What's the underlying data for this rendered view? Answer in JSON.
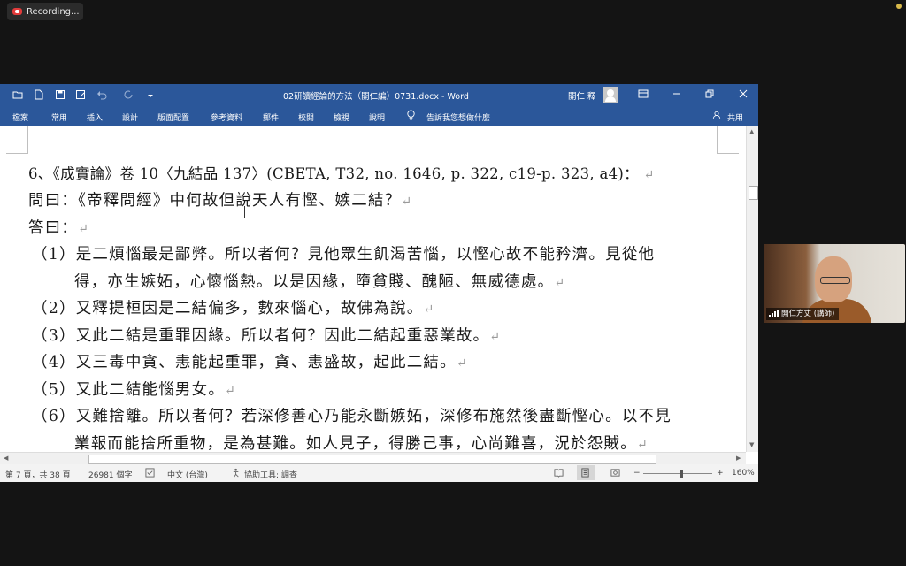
{
  "recording": {
    "label": "Recording..."
  },
  "word": {
    "doc_title": "02研讀經論的方法（開仁編）0731.docx  -  Word",
    "user": "開仁 釋",
    "tabs": [
      "檔案",
      "常用",
      "插入",
      "設計",
      "版面配置",
      "參考資料",
      "郵件",
      "校閱",
      "檢視",
      "說明"
    ],
    "tell_me": "告訴我您想做什麼",
    "share": "共用",
    "doc_lines": [
      "6、《成實論》卷 10〈九結品  137〉(CBETA, T32, no. 1646, p. 322, c19-p. 323, a4)：",
      "問曰：《帝釋問經》中何故但說天人有慳、嫉二結？",
      "答曰：",
      "（1）是二煩惱最是鄙弊。所以者何？見他眾生飢渴苦惱，以慳心故不能矜濟。見從他",
      "得，亦生嫉妬，心懷惱熱。以是因緣，墮貧賤、醜陋、無威德處。",
      "（2）又釋提桓因是二結偏多，數來惱心，故佛為說。",
      "（3）又此二結是重罪因緣。所以者何？因此二結起重惡業故。",
      "（4）又三毒中貪、恚能起重罪，貪、恚盛故，起此二結。",
      "（5）又此二結能惱男女。",
      "（6）又難捨離。所以者何？若深修善心乃能永斷嫉妬，深修布施然後盡斷慳心。以不見",
      "業報而能捨所重物，是為甚難。如人見子，得勝己事，心尚難喜，況於怨賊。"
    ],
    "paragraph_mark": "↵",
    "status": {
      "page": "第 7 頁，共 38 頁",
      "words": "26981 個字",
      "language": "中文 (台灣)",
      "accessibility": "協助工具: 調查",
      "zoom": "160%",
      "zoom_minus": "−",
      "zoom_plus": "+"
    }
  },
  "video": {
    "participant": "開仁方丈 (講師)"
  },
  "colors": {
    "word_blue": "#2b579a",
    "status_bg": "#f3f3f3",
    "zoom_bg": "#141414"
  }
}
